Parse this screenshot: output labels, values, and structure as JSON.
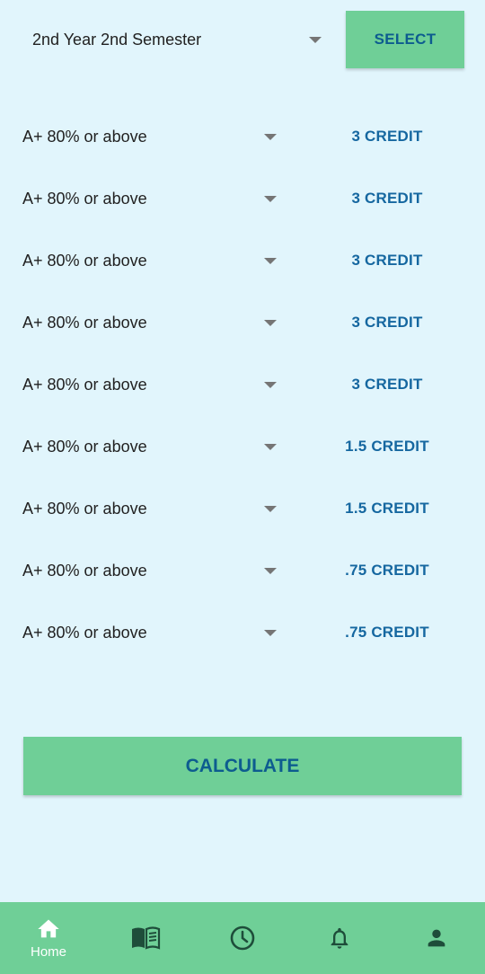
{
  "semester": {
    "selected": "2nd Year 2nd Semester",
    "select_button_label": "SELECT"
  },
  "courses": [
    {
      "grade": "A+ 80% or above",
      "credit": "3 CREDIT"
    },
    {
      "grade": "A+ 80% or above",
      "credit": "3 CREDIT"
    },
    {
      "grade": "A+ 80% or above",
      "credit": "3 CREDIT"
    },
    {
      "grade": "A+ 80% or above",
      "credit": "3 CREDIT"
    },
    {
      "grade": "A+ 80% or above",
      "credit": "3 CREDIT"
    },
    {
      "grade": "A+ 80% or above",
      "credit": "1.5 CREDIT"
    },
    {
      "grade": "A+ 80% or above",
      "credit": "1.5 CREDIT"
    },
    {
      "grade": "A+ 80% or above",
      "credit": ".75 CREDIT"
    },
    {
      "grade": "A+ 80% or above",
      "credit": ".75 CREDIT"
    }
  ],
  "calculate_label": "CALCULATE",
  "nav": {
    "items": [
      {
        "icon": "home-icon",
        "label": "Home",
        "active": true
      },
      {
        "icon": "book-icon",
        "label": "",
        "active": false
      },
      {
        "icon": "clock-icon",
        "label": "",
        "active": false
      },
      {
        "icon": "bell-icon",
        "label": "",
        "active": false
      },
      {
        "icon": "person-icon",
        "label": "",
        "active": false
      }
    ]
  },
  "colors": {
    "background": "#e1f5fc",
    "accent_green": "#6fcf97",
    "button_text": "#0d5c8f",
    "credit_text": "#1567a0",
    "nav_icon": "#1e4d3a",
    "nav_active_icon": "#ffffff"
  }
}
